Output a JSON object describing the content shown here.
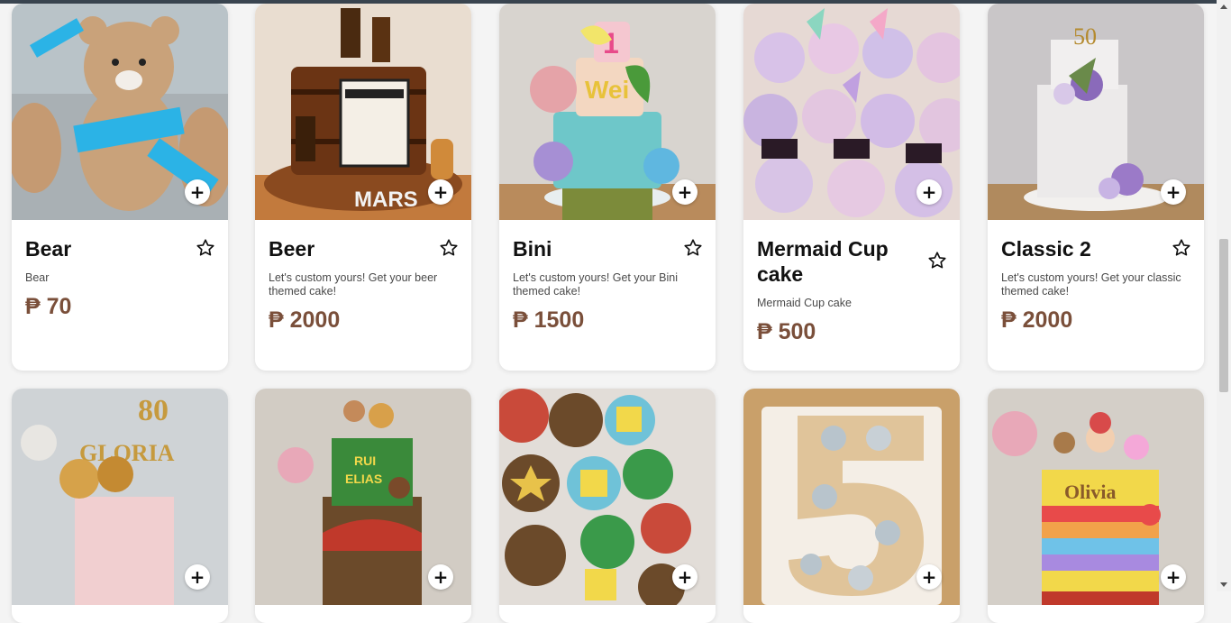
{
  "currency_symbol": "₱",
  "accent_color": "#7a4f3a",
  "products": [
    {
      "title": "Bear",
      "desc": "Bear",
      "price": "₱ 70"
    },
    {
      "title": "Beer",
      "desc": "Let's custom yours! Get your beer themed cake!",
      "price": "₱ 2000"
    },
    {
      "title": "Bini",
      "desc": "Let's custom yours! Get your Bini themed cake!",
      "price": "₱ 1500"
    },
    {
      "title": "Mermaid Cup cake",
      "desc": "Mermaid Cup cake",
      "price": "₱ 500"
    },
    {
      "title": "Classic 2",
      "desc": "Let's custom yours! Get your classic themed cake!",
      "price": "₱ 2000"
    }
  ],
  "image_cards": [
    {
      "name": "gloria-cake"
    },
    {
      "name": "jungle-cake"
    },
    {
      "name": "game-cupcakes"
    },
    {
      "name": "number-cake"
    },
    {
      "name": "olivia-cake"
    }
  ],
  "icons": {
    "add": "plus-icon",
    "favorite": "star-outline-icon"
  }
}
